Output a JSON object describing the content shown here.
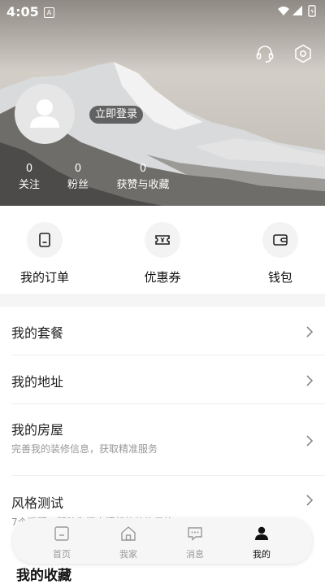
{
  "status_bar": {
    "time": "4:05",
    "notification_letter": "A"
  },
  "profile": {
    "login_label": "立即登录",
    "stats": [
      {
        "value": "0",
        "label": "关注"
      },
      {
        "value": "0",
        "label": "粉丝"
      },
      {
        "value": "0",
        "label": "获赞与收藏"
      }
    ]
  },
  "header_icons": [
    "headset-icon",
    "settings-hex-icon"
  ],
  "quick_actions": [
    {
      "label": "我的订单",
      "icon": "order-icon"
    },
    {
      "label": "优惠券",
      "icon": "coupon-icon"
    },
    {
      "label": "钱包",
      "icon": "wallet-icon"
    }
  ],
  "menu": {
    "items": [
      {
        "title": "我的套餐",
        "subtitle": ""
      },
      {
        "title": "我的地址",
        "subtitle": ""
      },
      {
        "title": "我的房屋",
        "subtitle": "完善我的装修信息，获取精准服务"
      },
      {
        "title": "风格测试",
        "subtitle": "7个问题，帮助你探索理想的装修风格"
      }
    ]
  },
  "tabbar": {
    "tabs": [
      {
        "label": "首页",
        "icon": "home-icon"
      },
      {
        "label": "我家",
        "icon": "house-icon"
      },
      {
        "label": "消息",
        "icon": "message-icon"
      },
      {
        "label": "我的",
        "icon": "profile-icon",
        "active": true
      }
    ]
  },
  "section_title": "我的收藏"
}
